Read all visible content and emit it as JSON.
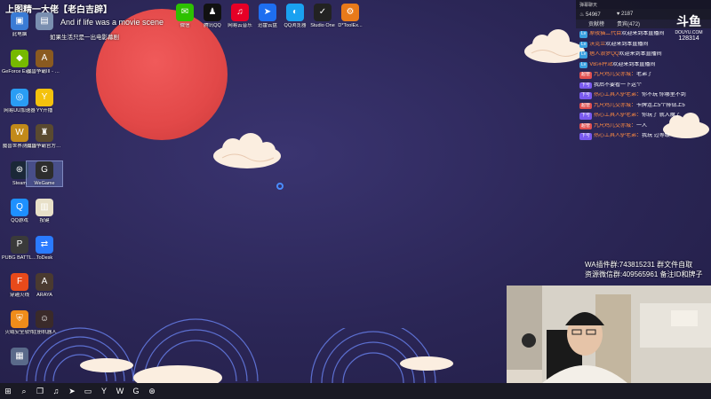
{
  "overlay": {
    "title": "上图精一大佬【老白吉辟】",
    "caption_en": "And if life was a movie scene",
    "caption_cn": "如果生活只是一出电影幕剧"
  },
  "desktop_icons": [
    {
      "label": "此电脑",
      "icon": "computer-icon",
      "color": "#3a7bd5"
    },
    {
      "label": "",
      "icon": "file-icon",
      "color": "#7a8fb0"
    },
    {
      "label": "GeForce Experience",
      "icon": "geforce-icon",
      "color": "#76b900"
    },
    {
      "label": "魔兽争霸III - 快捷方式",
      "icon": "warcraft-icon",
      "color": "#8a5a20"
    },
    {
      "label": "网易UU加速器",
      "icon": "uu-icon",
      "color": "#2a9df4"
    },
    {
      "label": "YY开播",
      "icon": "yy-icon",
      "color": "#f4c20d"
    },
    {
      "label": "魔兽世界测试版",
      "icon": "wow-icon",
      "color": "#c28a1a"
    },
    {
      "label": "魔兽争霸官方对战平台",
      "icon": "wc-platform-icon",
      "color": "#5a4a30"
    },
    {
      "label": "Steam",
      "icon": "steam-icon",
      "color": "#1b2838"
    },
    {
      "label": "WeGame",
      "icon": "wegame-icon",
      "color": "#2d2d2d"
    },
    {
      "label": "QQ游戏",
      "icon": "qqgame-icon",
      "color": "#1e90ff"
    },
    {
      "label": "按键",
      "icon": "note-icon",
      "color": "#e8e0c8"
    },
    {
      "label": "PUBG BATTLEGR...",
      "icon": "pubg-icon",
      "color": "#3a3a3a"
    },
    {
      "label": "ToDesk",
      "icon": "todesk-icon",
      "color": "#2a7bff"
    },
    {
      "label": "穿越火线",
      "icon": "cf-icon",
      "color": "#e84a1a"
    },
    {
      "label": "ARAYA",
      "icon": "araya-icon",
      "color": "#4a3a30"
    },
    {
      "label": "火绒安全软件",
      "icon": "huorong-icon",
      "color": "#f08c1a"
    },
    {
      "label": "注册机器人",
      "icon": "avatar-icon",
      "color": "#3a2a2a"
    },
    {
      "label": "",
      "icon": "app-icon",
      "color": "#5a6a8a"
    }
  ],
  "top_icons": [
    {
      "label": "微信",
      "icon": "wechat-icon",
      "color": "#2dc100"
    },
    {
      "label": "腾讯QQ",
      "icon": "qq-icon",
      "color": "#111111"
    },
    {
      "label": "网易云音乐",
      "icon": "netease-music-icon",
      "color": "#e60026"
    },
    {
      "label": "迅雷云盘",
      "icon": "xunlei-icon",
      "color": "#1e6ef0"
    },
    {
      "label": "QQ浏览器",
      "icon": "qqbrowser-icon",
      "color": "#1aa1f0"
    },
    {
      "label": "Studio One",
      "icon": "studio-one-icon",
      "color": "#222222"
    },
    {
      "label": "D*ToolEx...",
      "icon": "tool-icon",
      "color": "#e87a1a"
    }
  ],
  "chat": {
    "header": "弹幕聊天",
    "stats": [
      "54967",
      "2187"
    ],
    "tabs": [
      "贡献榜",
      "贵宾(472)"
    ],
    "logo": "斗鱼",
    "logo_sub": "DOUYU.COM",
    "room": "128314",
    "messages": [
      {
        "badge": "Lv",
        "user": "原夜猫二代目",
        "text": "欢迎来到本直播间"
      },
      {
        "badge": "Lv",
        "user": "沃克兰",
        "text": "欢迎来到本直播间"
      },
      {
        "badge": "Lv",
        "user": "痞人浪梦QQ",
        "text": "欢迎来到本直播间"
      },
      {
        "badge": "Lv",
        "user": "VB洋秤站",
        "text": "欢迎来到本直播间"
      },
      {
        "badge": "超管",
        "user": "九尺鸡儿交赤城：",
        "text": "老弟了"
      },
      {
        "badge": "下号",
        "user": "",
        "text": "我后不要看一下这个"
      },
      {
        "badge": "下号",
        "user": "热心工具人驴老弟：",
        "text": "你不玩 你哪里不到"
      },
      {
        "badge": "超管",
        "user": "九尺鸡儿交赤城：",
        "text": "卡牌连上5个排钻上5"
      },
      {
        "badge": "下号",
        "user": "热心工具人驴老弟：",
        "text": "你玩了 就入魔了"
      },
      {
        "badge": "超管",
        "user": "九尺鸡儿交赤城：",
        "text": "一人"
      },
      {
        "badge": "下号",
        "user": "热心工具人驴老弟：",
        "text": "我玩 过等级"
      }
    ]
  },
  "ad": {
    "line1": "WA插件群:743815231 群文件自取",
    "line2": "资源微信群:409565961 备注ID和牌子"
  },
  "taskbar": {
    "icons": [
      "windows-start-icon",
      "search-icon",
      "task-view-icon",
      "netease-music-icon",
      "xunlei-icon",
      "file-explorer-icon",
      "yy-icon",
      "wow-icon",
      "wegame-icon",
      "steam-icon"
    ]
  }
}
